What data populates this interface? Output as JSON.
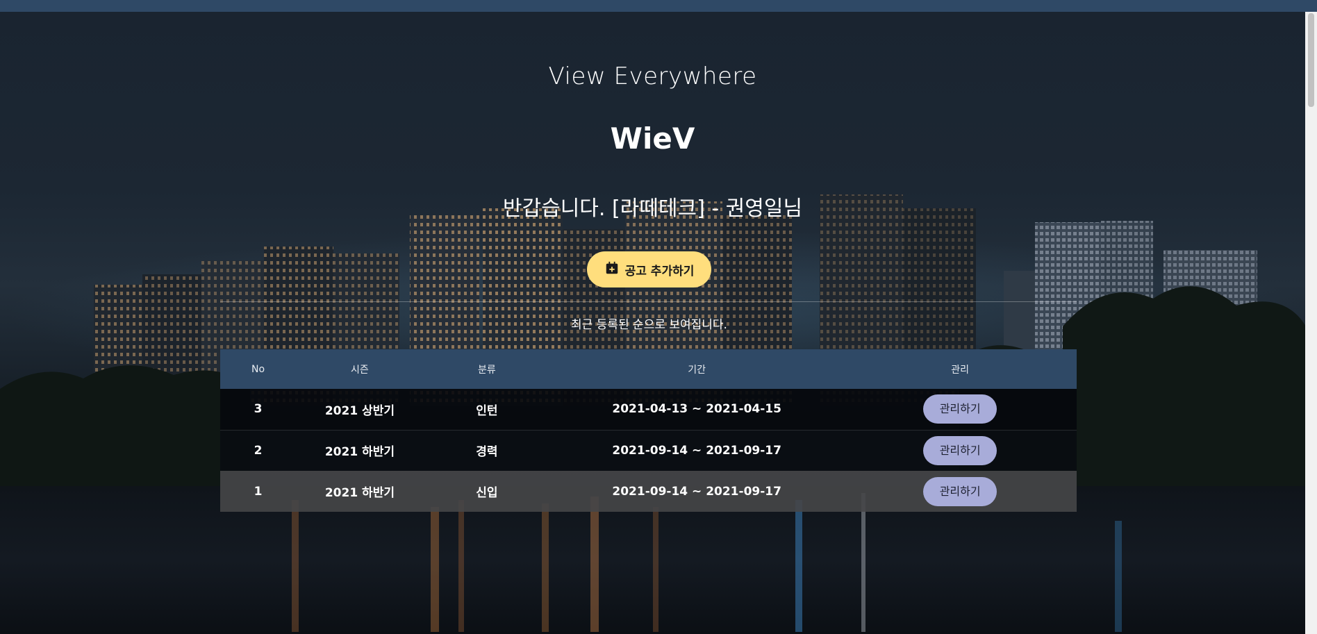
{
  "colors": {
    "topbar": "#2f4966",
    "table_header": "#2f4966",
    "add_button": "#ffde7d",
    "manage_button": "#a8acd9"
  },
  "hero": {
    "subtitle": "View Everywhere",
    "brand": "WieV",
    "greeting": "반갑습니다. [라떼테크] - 권영일님"
  },
  "add_button": {
    "icon": "calendar-plus-icon",
    "label": "공고 추가하기"
  },
  "caption": "최근 등록된 순으로 보여집니다.",
  "table": {
    "headers": {
      "no": "No",
      "season": "시즌",
      "category": "분류",
      "period": "기간",
      "manage": "관리"
    },
    "rows": [
      {
        "no": "3",
        "season": "2021 상반기",
        "category": "인턴",
        "period": "2021-04-13 ~ 2021-04-15",
        "manage": "관리하기"
      },
      {
        "no": "2",
        "season": "2021 하반기",
        "category": "경력",
        "period": "2021-09-14 ~ 2021-09-17",
        "manage": "관리하기"
      },
      {
        "no": "1",
        "season": "2021 하반기",
        "category": "신입",
        "period": "2021-09-14 ~ 2021-09-17",
        "manage": "관리하기"
      }
    ]
  }
}
